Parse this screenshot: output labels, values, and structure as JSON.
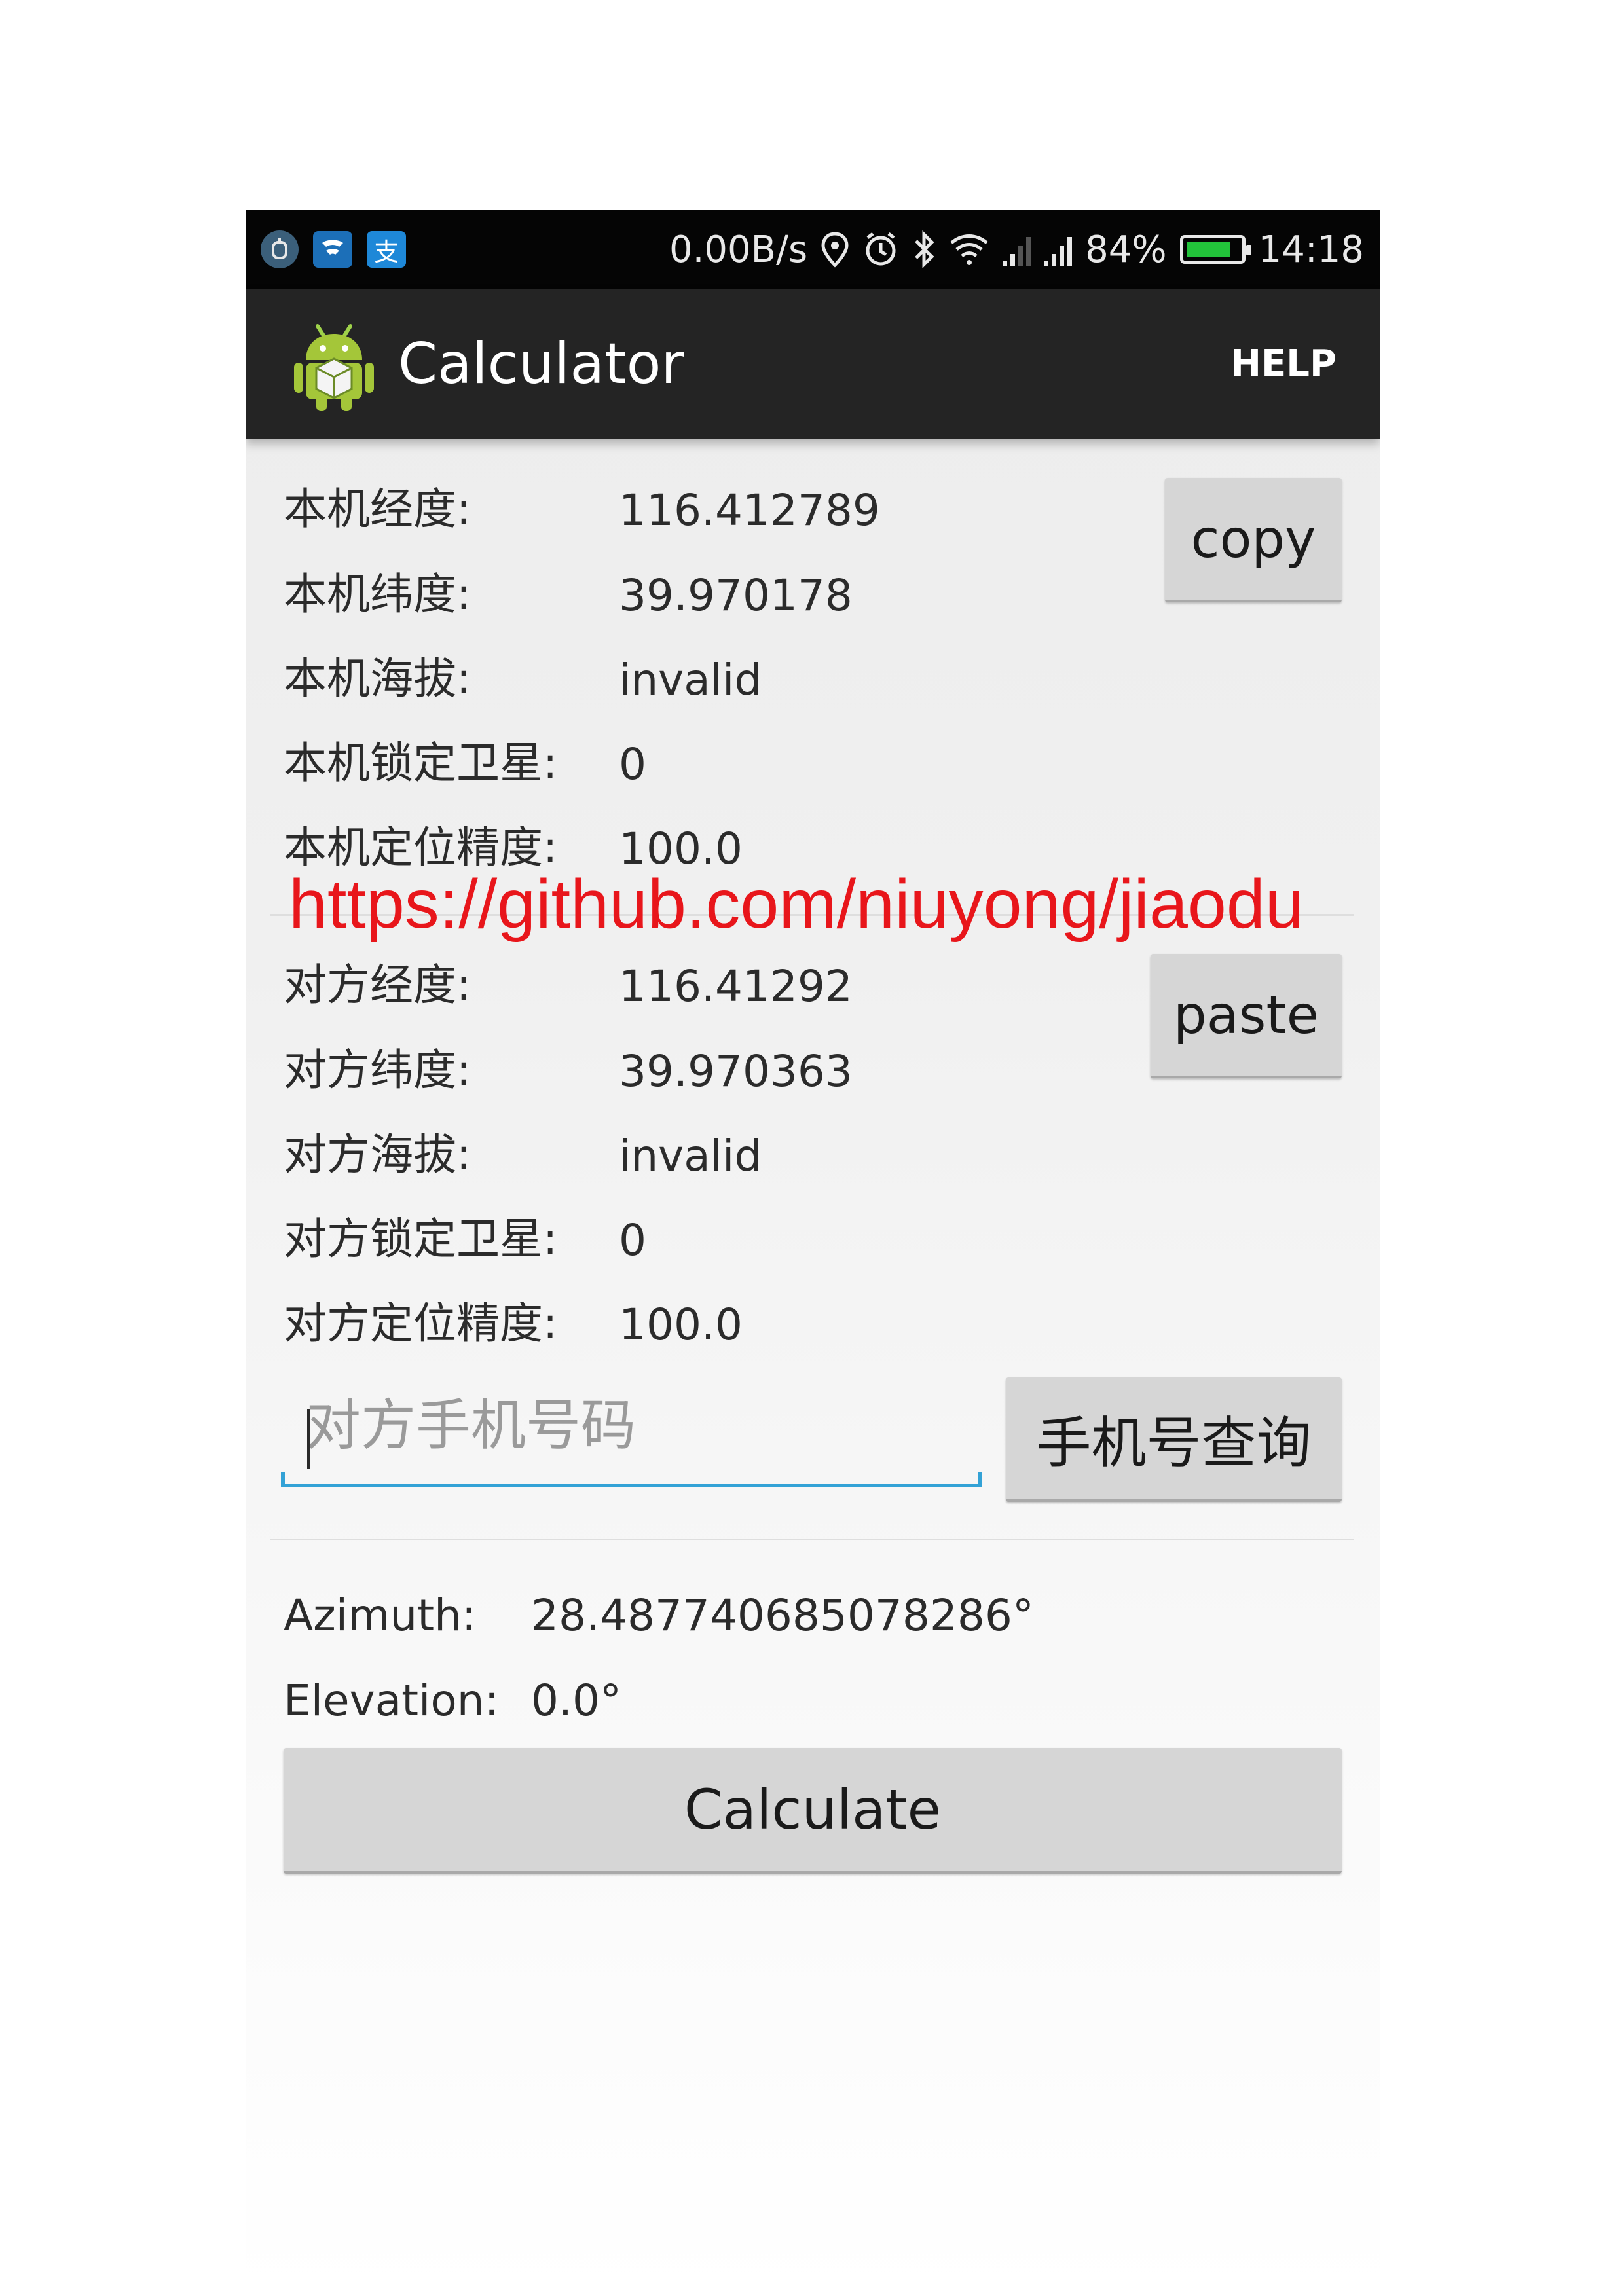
{
  "status_bar": {
    "notification_icons": [
      "app-notification-icon",
      "message-notification-icon",
      "alipay-icon"
    ],
    "alipay_glyph": "支",
    "network_speed": "0.00B/s",
    "battery_level": "84%",
    "battery_fraction": 0.84,
    "time": "14:18"
  },
  "action_bar": {
    "title": "Calculator",
    "help_label": "HELP"
  },
  "self_info": {
    "longitude_label": "本机经度:",
    "longitude_value": "116.412789",
    "latitude_label": "本机纬度:",
    "latitude_value": "39.970178",
    "altitude_label": "本机海拔:",
    "altitude_value": "invalid",
    "satellites_label": "本机锁定卫星:",
    "satellites_value": "0",
    "accuracy_label": "本机定位精度:",
    "accuracy_value": "100.0",
    "copy_label": "copy"
  },
  "watermark": "https://github.com/niuyong/jiaodu",
  "peer_info": {
    "longitude_label": "对方经度:",
    "longitude_value": "116.41292",
    "latitude_label": "对方纬度:",
    "latitude_value": "39.970363",
    "altitude_label": "对方海拔:",
    "altitude_value": "invalid",
    "satellites_label": "对方锁定卫星:",
    "satellites_value": "0",
    "accuracy_label": "对方定位精度:",
    "accuracy_value": "100.0",
    "paste_label": "paste"
  },
  "phone_query": {
    "placeholder": "对方手机号码",
    "value": "",
    "button_label": "手机号查询"
  },
  "results": {
    "azimuth_label": "Azimuth:",
    "azimuth_value": "28.487740685078286°",
    "elevation_label": "Elevation:",
    "elevation_value": "0.0°"
  },
  "calculate_label": "Calculate",
  "colors": {
    "status_bar": "#050505",
    "action_bar": "#242424",
    "input_underline": "#33a2d6",
    "watermark": "#e8161b",
    "battery_fill": "#22c33a"
  }
}
